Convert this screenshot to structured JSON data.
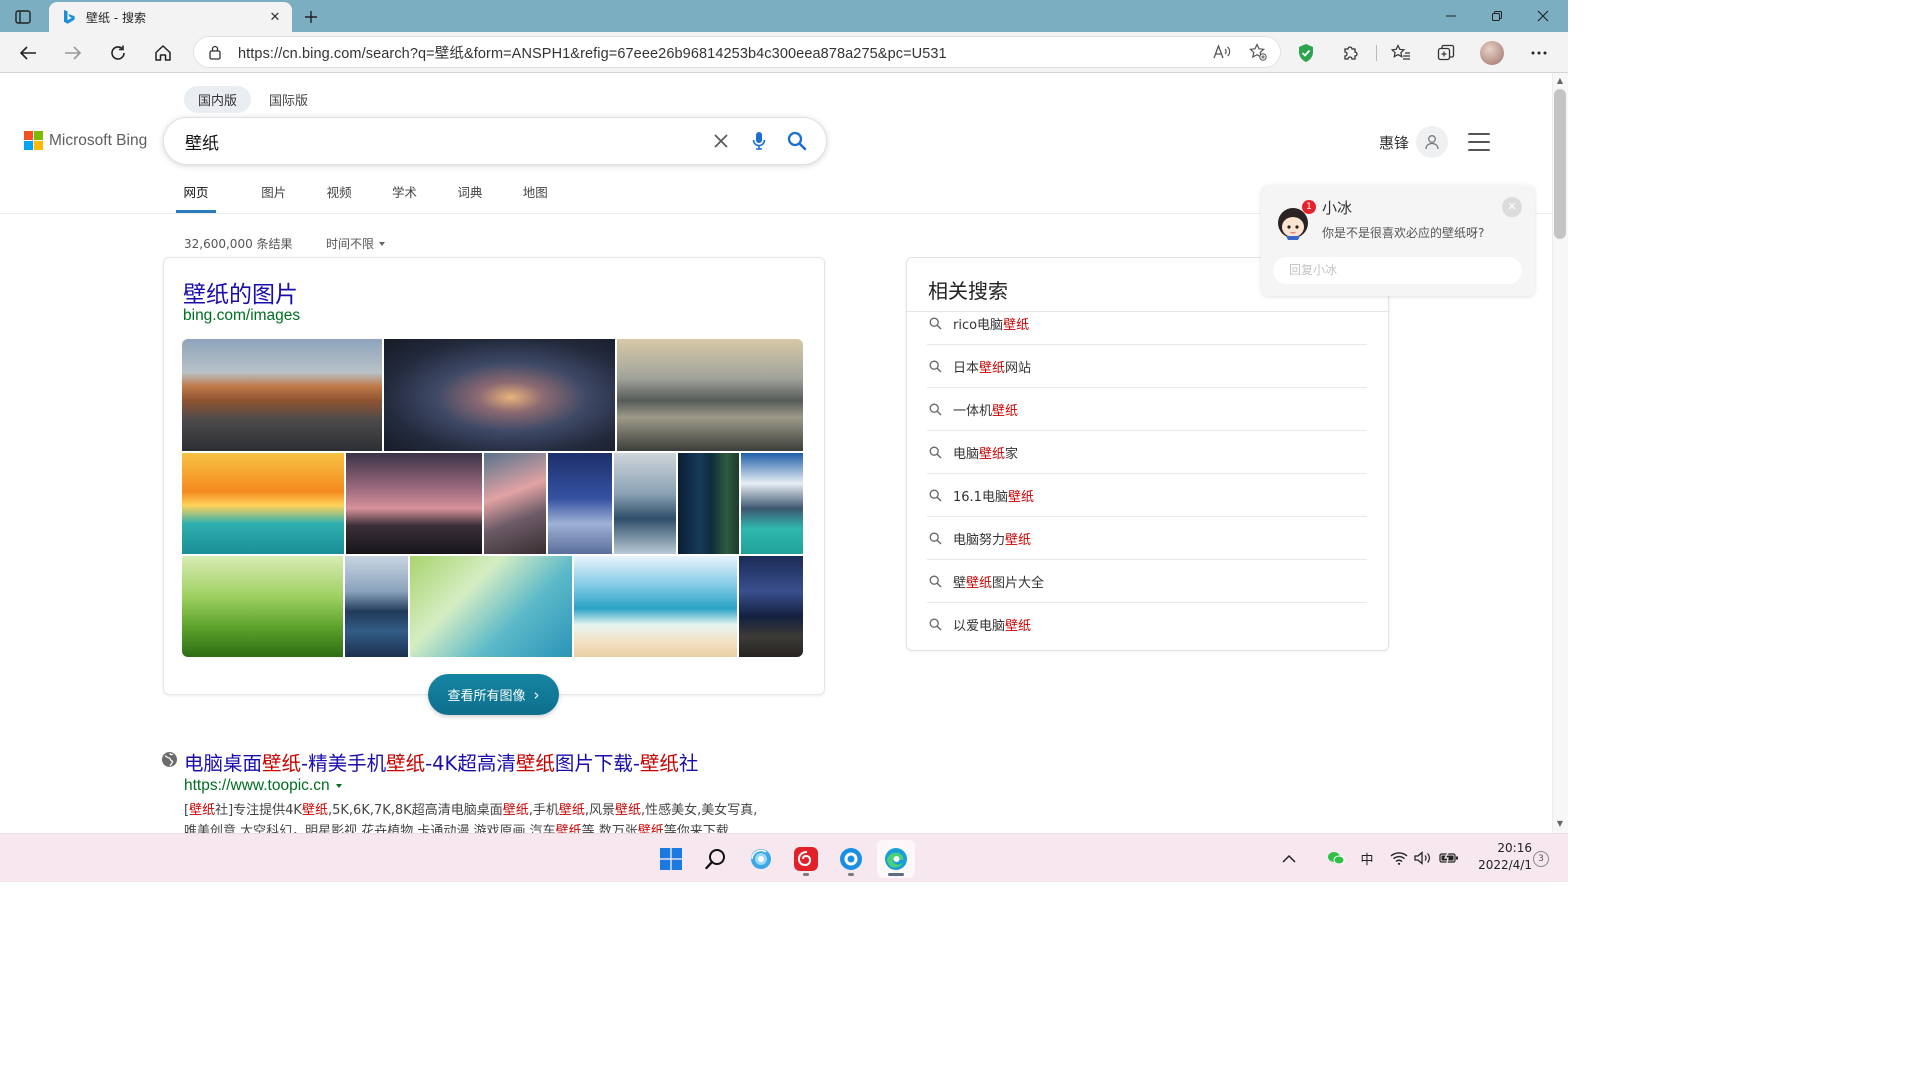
{
  "browser": {
    "tab_title": "壁纸 - 搜索",
    "url": "https://cn.bing.com/search?q=壁纸&form=ANSPH1&refig=67eee26b96814253b4c300eea878a275&pc=U531"
  },
  "header": {
    "markets": [
      "国内版",
      "国际版"
    ],
    "logo_text": "Microsoft Bing",
    "query": "壁纸",
    "user_name": "惠锋",
    "scopes": [
      "网页",
      "图片",
      "视频",
      "学术",
      "词典",
      "地图"
    ]
  },
  "results_meta": {
    "count": "32,600,000 条结果",
    "time_filter": "时间不限"
  },
  "images_card": {
    "title": "壁纸的图片",
    "url": "bing.com/images",
    "view_all": "查看所有图像"
  },
  "first_result": {
    "title_parts": [
      "电脑桌面",
      "壁纸",
      "-精美手机",
      "壁纸",
      "-4K超高清",
      "壁纸",
      "图片下载-",
      "壁纸",
      "社"
    ],
    "url": "https://www.toopic.cn",
    "snippet_line1": [
      "[",
      "壁纸",
      "社]专注提供4K",
      "壁纸",
      ",5K,6K,7K,8K超高清电脑桌面",
      "壁纸",
      ",手机",
      "壁纸",
      ",风景",
      "壁纸",
      ",性感美女,美女写真,"
    ],
    "snippet_line2": [
      "唯美创意,太空科幻，明星影视,花卉植物,卡通动漫,游戏原画,汽车",
      "壁纸",
      "等,数万张",
      "壁纸",
      "等你来下载"
    ]
  },
  "related": {
    "title": "相关搜索",
    "items": [
      {
        "pre": "rico电脑",
        "hl": "壁纸",
        "post": ""
      },
      {
        "pre": "日本",
        "hl": "壁纸",
        "post": "网站"
      },
      {
        "pre": "一体机",
        "hl": "壁纸",
        "post": ""
      },
      {
        "pre": "电脑",
        "hl": "壁纸",
        "post": "家"
      },
      {
        "pre": "16.1电脑",
        "hl": "壁纸",
        "post": ""
      },
      {
        "pre": "电脑努力",
        "hl": "壁纸",
        "post": ""
      },
      {
        "pre": "壁",
        "hl": "壁纸",
        "post": "图片大全"
      },
      {
        "pre": "以爱电脑",
        "hl": "壁纸",
        "post": ""
      }
    ]
  },
  "xiaobing": {
    "name": "小冰",
    "badge": "1",
    "message": "你是不是很喜欢必应的壁纸呀?",
    "input_placeholder": "回复小冰"
  },
  "taskbar": {
    "ime": "中",
    "time": "20:16",
    "date": "2022/4/1",
    "notifications": "3"
  },
  "colors": {
    "link": "#1a0dab",
    "url_green": "#006d21",
    "highlight": "#c80000",
    "view_all_btn": "#0f7a97",
    "tab_strip": "#7aaec0"
  }
}
